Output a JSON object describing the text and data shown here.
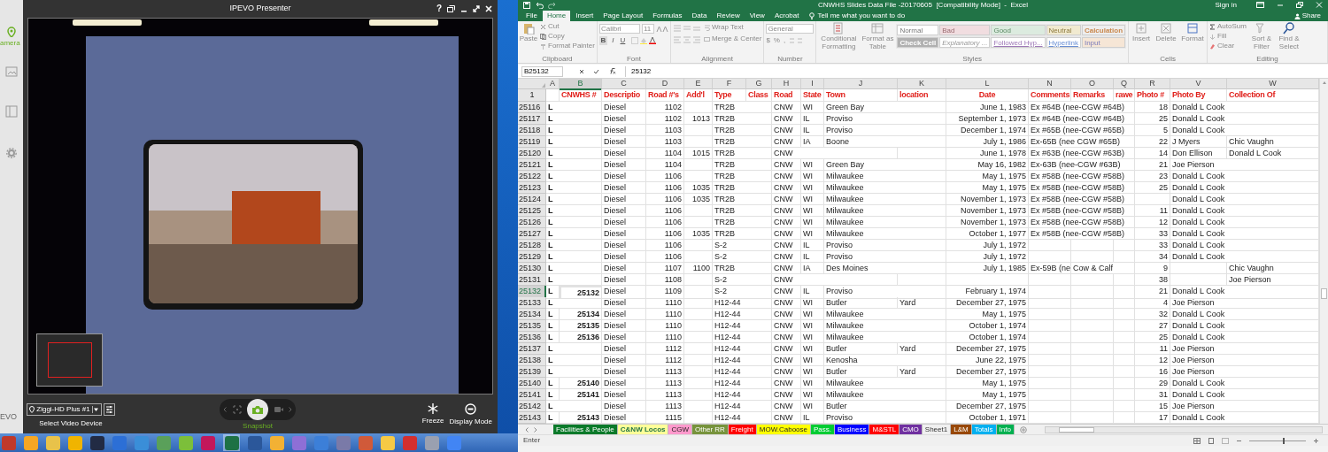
{
  "ipevo": {
    "title": "IPEVO Presenter",
    "help_glyph": "?",
    "sidebar_label": "amera",
    "brand_fragment": "EVO",
    "device": {
      "value": "Ziggi-HD Plus #1",
      "caption": "Select Video Device"
    },
    "snapshot_label": "Snapshot",
    "actions": [
      {
        "kind": "freeze",
        "label": "Freeze"
      },
      {
        "kind": "display",
        "label": "Display Mode"
      }
    ]
  },
  "excel": {
    "title": "CNWHS Slides Data File -20170605  [Compatibility Mode]  -  Excel",
    "sign_in": "Sign in",
    "tabs": [
      {
        "label": "File",
        "selected": false
      },
      {
        "label": "Home",
        "selected": true
      },
      {
        "label": "Insert",
        "selected": false
      },
      {
        "label": "Page Layout",
        "selected": false
      },
      {
        "label": "Formulas",
        "selected": false
      },
      {
        "label": "Data",
        "selected": false
      },
      {
        "label": "Review",
        "selected": false
      },
      {
        "label": "View",
        "selected": false
      },
      {
        "label": "Acrobat",
        "selected": false
      }
    ],
    "tell_me": "Tell me what you want to do",
    "share": "Share",
    "ribbon": [
      {
        "kind": "clipboard",
        "name": "Clipboard",
        "big": "Paste",
        "items": [
          "Cut",
          "Copy",
          "Format Painter"
        ]
      },
      {
        "kind": "font",
        "name": "Font",
        "font": "Calibri",
        "size": "11",
        "styles": [
          "B",
          "I",
          "U"
        ]
      },
      {
        "kind": "alignment",
        "name": "Alignment",
        "items": [
          "Wrap Text",
          "Merge & Center"
        ]
      },
      {
        "kind": "number",
        "name": "Number",
        "format": "General",
        "symbols": [
          "$",
          "%",
          ","
        ]
      },
      {
        "kind": "styles",
        "name": "Styles",
        "big": [
          "Conditional Formatting",
          "Format as Table"
        ],
        "cell_styles": [
          "Normal",
          "Bad",
          "Good",
          "Neutral",
          "Calculation",
          "Check Cell",
          "Explanatory ...",
          "Followed Hyp...",
          "Hyperlink",
          "Input"
        ]
      },
      {
        "kind": "cells",
        "name": "Cells",
        "items": [
          "Insert",
          "Delete",
          "Format"
        ]
      },
      {
        "kind": "editing",
        "name": "Editing",
        "items": [
          "AutoSum",
          "Fill",
          "Clear"
        ],
        "big": [
          "Sort & Filter",
          "Find & Select"
        ]
      }
    ],
    "name_box": "B25132",
    "formula": "25132",
    "columns": [
      {
        "letter": "A",
        "selected": false
      },
      {
        "letter": "B",
        "selected": true
      },
      {
        "letter": "C",
        "selected": false
      },
      {
        "letter": "D",
        "selected": false
      },
      {
        "letter": "E",
        "selected": false
      },
      {
        "letter": "F",
        "selected": false
      },
      {
        "letter": "G",
        "selected": false
      },
      {
        "letter": "H",
        "selected": false
      },
      {
        "letter": "I",
        "selected": false
      },
      {
        "letter": "J",
        "selected": false
      },
      {
        "letter": "K",
        "selected": false
      },
      {
        "letter": "L",
        "selected": false
      },
      {
        "letter": "N",
        "selected": false
      },
      {
        "letter": "O",
        "selected": false
      },
      {
        "letter": "Q",
        "selected": false
      },
      {
        "letter": "R",
        "selected": false
      },
      {
        "letter": "V",
        "selected": false
      },
      {
        "letter": "W",
        "selected": false
      }
    ],
    "header_row": {
      "row": "1",
      "cells": {
        "B": "CNWHS #",
        "C": "Descriptio",
        "D": "Road #'s",
        "E": "Add'l",
        "F": "Type",
        "G": "Class",
        "H": "Road",
        "I": "State",
        "J": "Town",
        "K": "location",
        "L": "Date",
        "N": "Comments",
        "O": "Remarks",
        "Q": "rawe",
        "R": "Photo #",
        "V": "Photo By",
        "W": "Collection Of"
      }
    },
    "rows": [
      {
        "row": "25116",
        "selected": false,
        "cells": {
          "A": "L",
          "C": "Diesel",
          "D": "1102",
          "F": "TR2B",
          "H": "CNW",
          "I": "WI",
          "J": "Green Bay",
          "L": "June 1, 1983",
          "N": "Ex #64B (nee-CGW #64B)",
          "R": "18",
          "V": "Donald L Cook"
        }
      },
      {
        "row": "25117",
        "selected": false,
        "cells": {
          "A": "L",
          "C": "Diesel",
          "D": "1102",
          "E": "1013",
          "F": "TR2B",
          "H": "CNW",
          "I": "IL",
          "J": "Proviso",
          "L": "September 1, 1973",
          "N": "Ex #64B (nee-CGW #64B)",
          "R": "25",
          "V": "Donald L Cook"
        }
      },
      {
        "row": "25118",
        "selected": false,
        "cells": {
          "A": "L",
          "C": "Diesel",
          "D": "1103",
          "F": "TR2B",
          "H": "CNW",
          "I": "IL",
          "J": "Proviso",
          "L": "December 1, 1974",
          "N": "Ex #65B (nee-CGW #65B)",
          "R": "5",
          "V": "Donald L Cook"
        }
      },
      {
        "row": "25119",
        "selected": false,
        "cells": {
          "A": "L",
          "C": "Diesel",
          "D": "1103",
          "F": "TR2B",
          "H": "CNW",
          "I": "IA",
          "J": "Boone",
          "L": "July 1, 1986",
          "N": "Ex-65B (nee CGW #65B)",
          "R": "22",
          "V": "J Myers",
          "W": "Chic Vaughn"
        }
      },
      {
        "row": "25120",
        "selected": false,
        "cells": {
          "A": "L",
          "C": "Diesel",
          "D": "1104",
          "E": "1015",
          "F": "TR2B",
          "H": "CNW",
          "L": "June 1, 1978",
          "N": "Ex #63B (nee-CGW #63B)",
          "R": "14",
          "V": "Don Ellison",
          "W": "Donald L Cook"
        }
      },
      {
        "row": "25121",
        "selected": false,
        "cells": {
          "A": "L",
          "C": "Diesel",
          "D": "1104",
          "F": "TR2B",
          "H": "CNW",
          "I": "WI",
          "J": "Green Bay",
          "L": "May 16, 1982",
          "N": "Ex-63B (nee-CGW #63B)",
          "R": "21",
          "V": "Joe Pierson"
        }
      },
      {
        "row": "25122",
        "selected": false,
        "cells": {
          "A": "L",
          "C": "Diesel",
          "D": "1106",
          "F": "TR2B",
          "H": "CNW",
          "I": "WI",
          "J": "Milwaukee",
          "L": "May 1, 1975",
          "N": "Ex #58B (nee-CGW #58B)",
          "R": "23",
          "V": "Donald L Cook"
        }
      },
      {
        "row": "25123",
        "selected": false,
        "cells": {
          "A": "L",
          "C": "Diesel",
          "D": "1106",
          "E": "1035",
          "F": "TR2B",
          "H": "CNW",
          "I": "WI",
          "J": "Milwaukee",
          "L": "May 1, 1975",
          "N": "Ex #58B (nee-CGW #58B)",
          "R": "25",
          "V": "Donald L Cook"
        }
      },
      {
        "row": "25124",
        "selected": false,
        "cells": {
          "A": "L",
          "C": "Diesel",
          "D": "1106",
          "E": "1035",
          "F": "TR2B",
          "H": "CNW",
          "I": "WI",
          "J": "Milwaukee",
          "L": "November 1, 1973",
          "N": "Ex #58B (nee-CGW #58B)",
          "V": "Donald L Cook"
        }
      },
      {
        "row": "25125",
        "selected": false,
        "cells": {
          "A": "L",
          "C": "Diesel",
          "D": "1106",
          "F": "TR2B",
          "H": "CNW",
          "I": "WI",
          "J": "Milwaukee",
          "L": "November 1, 1973",
          "N": "Ex #58B (nee-CGW #58B)",
          "R": "11",
          "V": "Donald L Cook"
        }
      },
      {
        "row": "25126",
        "selected": false,
        "cells": {
          "A": "L",
          "C": "Diesel",
          "D": "1106",
          "F": "TR2B",
          "H": "CNW",
          "I": "WI",
          "J": "Milwaukee",
          "L": "November 1, 1973",
          "N": "Ex #58B (nee-CGW #58B)",
          "R": "12",
          "V": "Donald L Cook"
        }
      },
      {
        "row": "25127",
        "selected": false,
        "cells": {
          "A": "L",
          "C": "Diesel",
          "D": "1106",
          "E": "1035",
          "F": "TR2B",
          "H": "CNW",
          "I": "WI",
          "J": "Milwaukee",
          "L": "October 1, 1977",
          "N": "Ex #58B (nee-CGW #58B)",
          "R": "33",
          "V": "Donald L Cook"
        }
      },
      {
        "row": "25128",
        "selected": false,
        "cells": {
          "A": "L",
          "C": "Diesel",
          "D": "1106",
          "F": "S-2",
          "H": "CNW",
          "I": "IL",
          "J": "Proviso",
          "L": "July 1, 1972",
          "R": "33",
          "V": "Donald L Cook"
        }
      },
      {
        "row": "25129",
        "selected": false,
        "cells": {
          "A": "L",
          "C": "Diesel",
          "D": "1106",
          "F": "S-2",
          "H": "CNW",
          "I": "IL",
          "J": "Proviso",
          "L": "July 1, 1972",
          "R": "34",
          "V": "Donald L Cook"
        }
      },
      {
        "row": "25130",
        "selected": false,
        "cells": {
          "A": "L",
          "C": "Diesel",
          "D": "1107",
          "E": "1100",
          "F": "TR2B",
          "H": "CNW",
          "I": "IA",
          "J": "Des Moines",
          "L": "July 1, 1985",
          "N": "Ex-59B (ne",
          "O": "Cow & Calf",
          "R": "9",
          "W": "Chic Vaughn"
        }
      },
      {
        "row": "25131",
        "selected": false,
        "cells": {
          "A": "L",
          "C": "Diesel",
          "D": "1108",
          "F": "S-2",
          "H": "CNW",
          "R": "38",
          "W": "Joe Pierson"
        }
      },
      {
        "row": "25132",
        "selected": true,
        "cells": {
          "A": "L",
          "B": "25132",
          "C": "Diesel",
          "D": "1109",
          "F": "S-2",
          "H": "CNW",
          "I": "IL",
          "J": "Proviso",
          "L": "February 1, 1974",
          "R": "21",
          "V": "Donald L Cook"
        }
      },
      {
        "row": "25133",
        "selected": false,
        "cells": {
          "A": "L",
          "C": "Diesel",
          "D": "1110",
          "F": "H12-44",
          "H": "CNW",
          "I": "WI",
          "J": "Butler",
          "K": "Yard",
          "L": "December 27, 1975",
          "R": "4",
          "V": "Joe Pierson"
        }
      },
      {
        "row": "25134",
        "selected": false,
        "cells": {
          "A": "L",
          "B": "25134",
          "C": "Diesel",
          "D": "1110",
          "F": "H12-44",
          "H": "CNW",
          "I": "WI",
          "J": "Milwaukee",
          "L": "May 1, 1975",
          "R": "32",
          "V": "Donald L Cook"
        }
      },
      {
        "row": "25135",
        "selected": false,
        "cells": {
          "A": "L",
          "B": "25135",
          "C": "Diesel",
          "D": "1110",
          "F": "H12-44",
          "H": "CNW",
          "I": "WI",
          "J": "Milwaukee",
          "L": "October 1, 1974",
          "R": "27",
          "V": "Donald L Cook"
        }
      },
      {
        "row": "25136",
        "selected": false,
        "cells": {
          "A": "L",
          "B": "25136",
          "C": "Diesel",
          "D": "1110",
          "F": "H12-44",
          "H": "CNW",
          "I": "WI",
          "J": "Milwaukee",
          "L": "October 1, 1974",
          "R": "25",
          "V": "Donald L Cook"
        }
      },
      {
        "row": "25137",
        "selected": false,
        "cells": {
          "A": "L",
          "C": "Diesel",
          "D": "1112",
          "F": "H12-44",
          "H": "CNW",
          "I": "WI",
          "J": "Butler",
          "K": "Yard",
          "L": "December 27, 1975",
          "R": "11",
          "V": "Joe Pierson"
        }
      },
      {
        "row": "25138",
        "selected": false,
        "cells": {
          "A": "L",
          "C": "Diesel",
          "D": "1112",
          "F": "H12-44",
          "H": "CNW",
          "I": "WI",
          "J": "Kenosha",
          "L": "June 22, 1975",
          "R": "12",
          "V": "Joe Pierson"
        }
      },
      {
        "row": "25139",
        "selected": false,
        "cells": {
          "A": "L",
          "C": "Diesel",
          "D": "1113",
          "F": "H12-44",
          "H": "CNW",
          "I": "WI",
          "J": "Butler",
          "K": "Yard",
          "L": "December 27, 1975",
          "R": "16",
          "V": "Joe Pierson"
        }
      },
      {
        "row": "25140",
        "selected": false,
        "cells": {
          "A": "L",
          "B": "25140",
          "C": "Diesel",
          "D": "1113",
          "F": "H12-44",
          "H": "CNW",
          "I": "WI",
          "J": "Milwaukee",
          "L": "May 1, 1975",
          "R": "29",
          "V": "Donald L Cook"
        }
      },
      {
        "row": "25141",
        "selected": false,
        "cells": {
          "A": "L",
          "B": "25141",
          "C": "Diesel",
          "D": "1113",
          "F": "H12-44",
          "H": "CNW",
          "I": "WI",
          "J": "Milwaukee",
          "L": "May 1, 1975",
          "R": "31",
          "V": "Donald L Cook"
        }
      },
      {
        "row": "25142",
        "selected": false,
        "cells": {
          "A": "L",
          "C": "Diesel",
          "D": "1113",
          "F": "H12-44",
          "H": "CNW",
          "I": "WI",
          "J": "Butler",
          "L": "December 27, 1975",
          "R": "15",
          "V": "Joe Pierson"
        }
      },
      {
        "row": "25143",
        "selected": false,
        "cells": {
          "A": "L",
          "B": "25143",
          "C": "Diesel",
          "D": "1115",
          "F": "H12-44",
          "H": "CNW",
          "I": "IL",
          "J": "Proviso",
          "L": "October 1, 1971",
          "R": "17",
          "V": "Donald L Cook"
        }
      }
    ],
    "sheet_tabs": [
      {
        "label": "Facilities & People",
        "color": "#0b7a2a",
        "selected": false
      },
      {
        "label": "C&NW Locos",
        "color": "#ffff99",
        "selected": true
      },
      {
        "label": "CGW",
        "color": "#ff99cc",
        "selected": false
      },
      {
        "label": "Other RR",
        "color": "#77933c",
        "selected": false
      },
      {
        "label": "Freight",
        "color": "#ff0000",
        "selected": false
      },
      {
        "label": "MOW.Caboose",
        "color": "#ffff00",
        "selected": false
      },
      {
        "label": "Pass.",
        "color": "#00cc33",
        "selected": false
      },
      {
        "label": "Business",
        "color": "#0000ff",
        "selected": false
      },
      {
        "label": "M&STL",
        "color": "#ff0000",
        "selected": false
      },
      {
        "label": "CMO",
        "color": "#7030a0",
        "selected": false
      },
      {
        "label": "Sheet1",
        "selected": false
      },
      {
        "label": "L&M",
        "color": "#984807",
        "selected": false
      },
      {
        "label": "Totals",
        "color": "#00b0f0",
        "selected": false
      },
      {
        "label": "Info",
        "color": "#00b050",
        "selected": false
      }
    ],
    "status": "Enter",
    "zoom_slider": {
      "level": 0.62
    }
  }
}
